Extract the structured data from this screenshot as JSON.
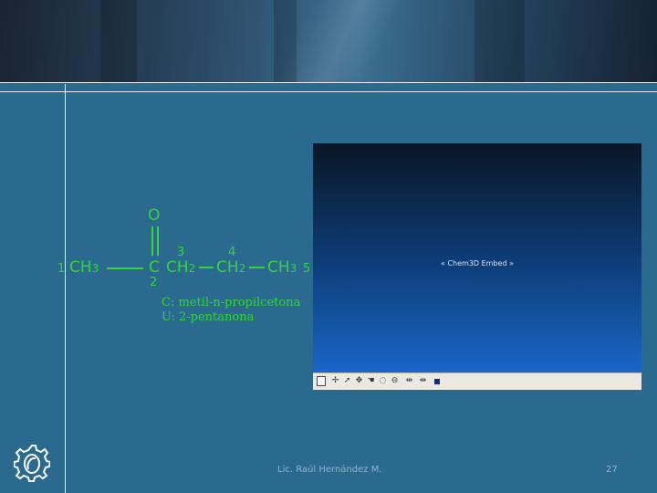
{
  "chem": {
    "o": "O",
    "c1_num": "1",
    "c1": "CH",
    "c1_sub": "3",
    "c2": "C",
    "c2_num": "2",
    "c3": "CH",
    "c3_sub": "2",
    "c3_num": "3",
    "c4": "CH",
    "c4_sub": "2",
    "c4_num": "4",
    "c5": "CH",
    "c5_sub": "3",
    "c5_num": "5",
    "common_name": "C: metil-n-propilcetona",
    "iupac_name": "U: 2-pentanona"
  },
  "embed": {
    "label": "« Chem3D Embed »"
  },
  "toolbar_icons": [
    "document-icon",
    "rotate-icon",
    "pointer-icon",
    "move-icon",
    "hand-icon",
    "zoom-icon",
    "trackball-icon",
    "x-rotate-icon",
    "y-rotate-icon",
    "stop-icon"
  ],
  "footer": {
    "author": "Lic. Raúl Hernández M.",
    "page": "27"
  },
  "colors": {
    "background": "#2b6a8f",
    "structure": "#33d633",
    "footer_text": "#8fb5cd"
  }
}
